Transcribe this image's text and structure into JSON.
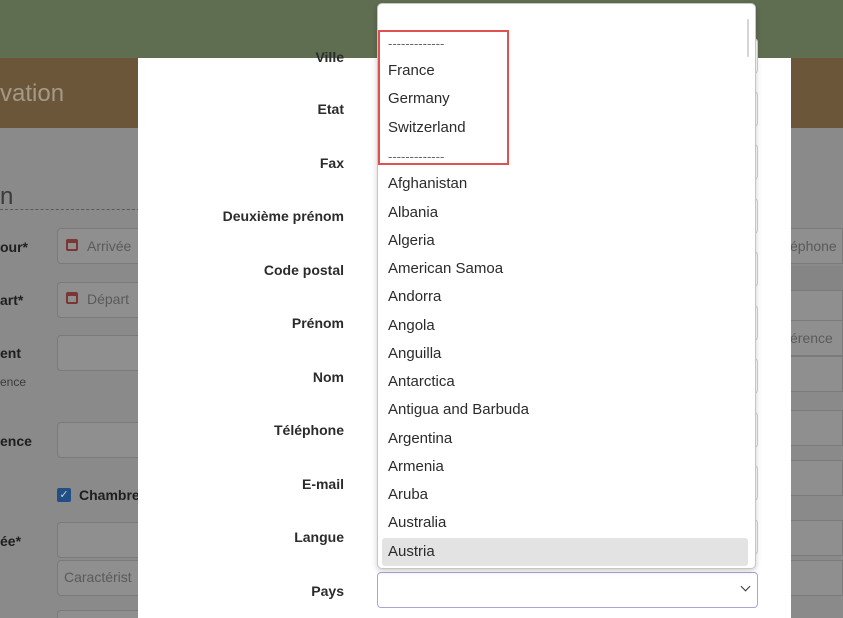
{
  "page": {
    "banner_title": "vation",
    "section_title": "n"
  },
  "background_form": {
    "labels": [
      "our*",
      "art*",
      "ent",
      "ence",
      "ée*"
    ],
    "small_label": "ence",
    "placeholders": {
      "arrival": "Arrivée",
      "departure": "Départ",
      "characteristics": "Caractérist",
      "phone": "éphone",
      "reference": "érence"
    },
    "checkbox_label": "Chambre",
    "checkbox_mark": "✓"
  },
  "modal": {
    "fields": [
      {
        "label": "Ville"
      },
      {
        "label": "Etat"
      },
      {
        "label": "Fax"
      },
      {
        "label": "Deuxième prénom"
      },
      {
        "label": "Code postal"
      },
      {
        "label": "Prénom"
      },
      {
        "label": "Nom"
      },
      {
        "label": "Téléphone"
      },
      {
        "label": "E-mail"
      },
      {
        "label": "Langue"
      },
      {
        "label": "Pays"
      }
    ],
    "pays_selected_value": ""
  },
  "dropdown": {
    "items": [
      "-------------",
      "France",
      "Germany",
      "Switzerland",
      "-------------",
      "Afghanistan",
      "Albania",
      "Algeria",
      "American Samoa",
      "Andorra",
      "Angola",
      "Anguilla",
      "Antarctica",
      "Antigua and Barbuda",
      "Argentina",
      "Armenia",
      "Aruba",
      "Australia",
      "Austria"
    ],
    "highlighted": "Austria"
  },
  "colors": {
    "topbar": "#5f6d51",
    "banner": "#6b5639",
    "highlight_border": "#e05252",
    "selected_bg": "#e3e3e3"
  }
}
